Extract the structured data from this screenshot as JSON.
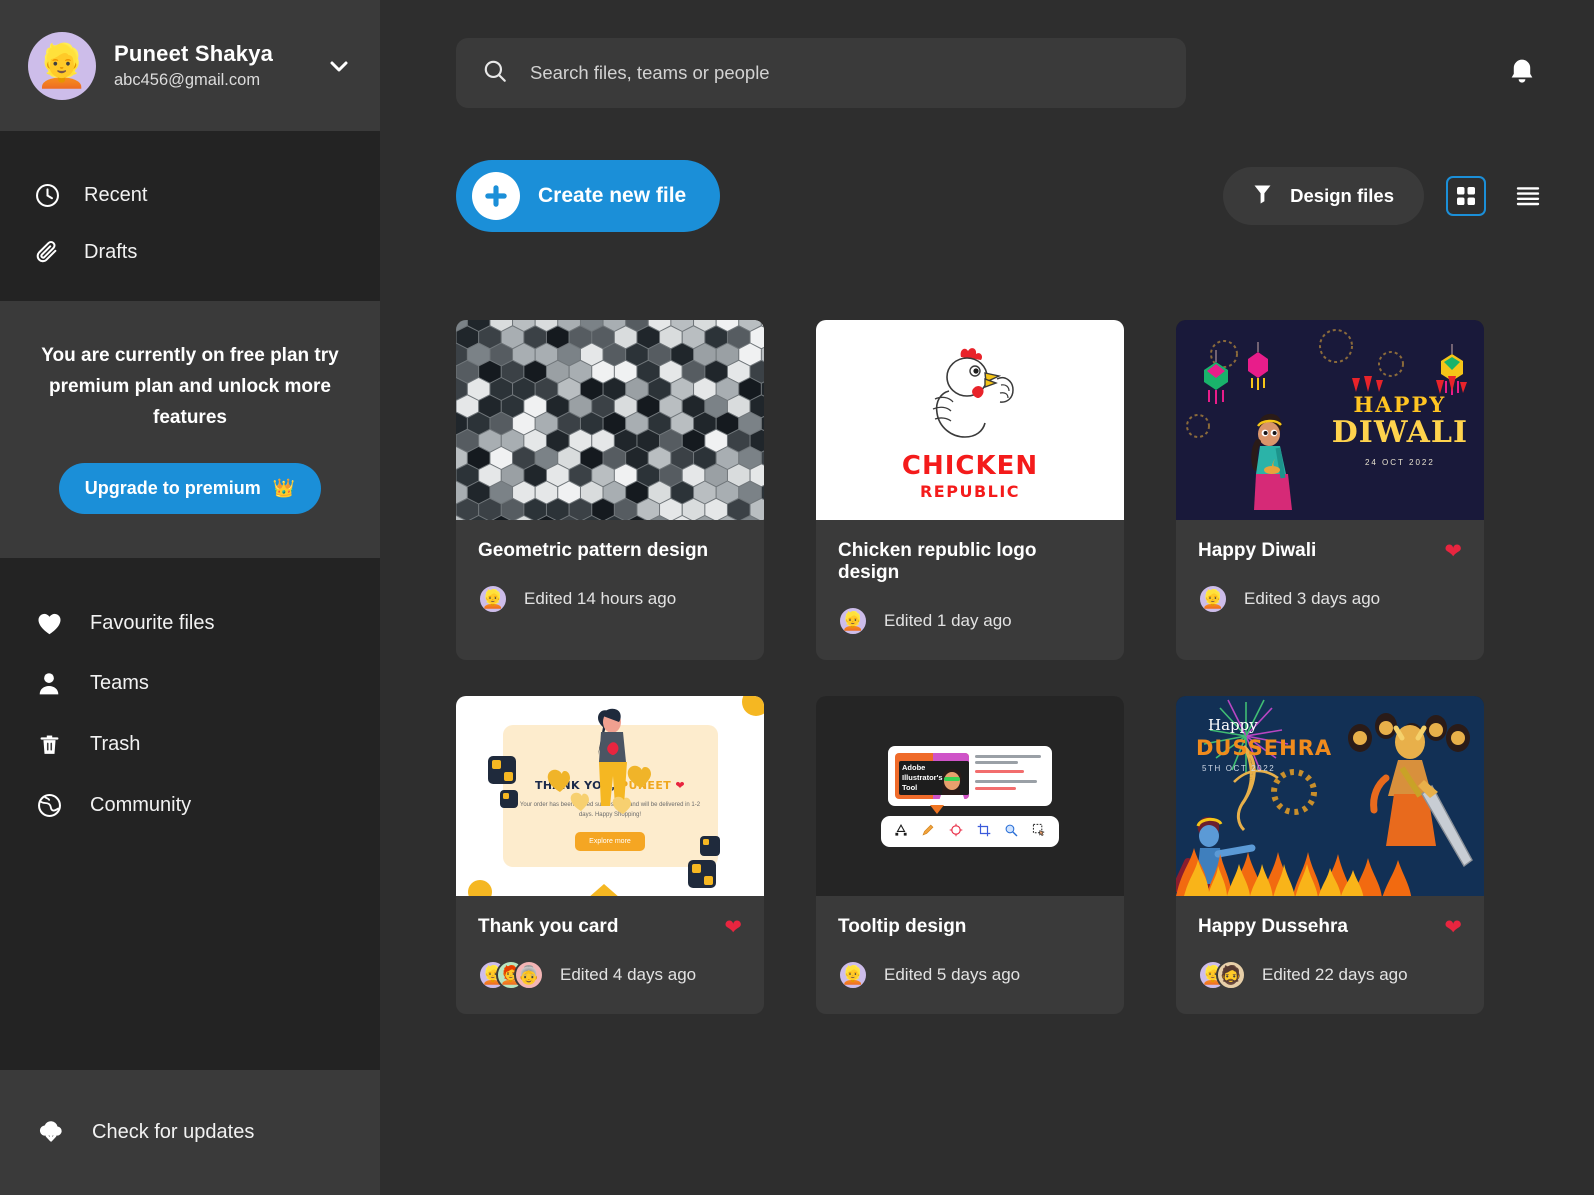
{
  "profile": {
    "name": "Puneet Shakya",
    "email": "abc456@gmail.com",
    "avatar_emoji": "👱",
    "chevron_icon": "chevron-down-icon"
  },
  "sidebar": {
    "nav_top": [
      {
        "label": "Recent",
        "icon": "clock-icon"
      },
      {
        "label": "Drafts",
        "icon": "paperclip-icon"
      }
    ],
    "promo": {
      "text": "You are currently on free plan try premium plan and unlock more features",
      "button_label": "Upgrade to premium",
      "button_icon": "👑",
      "accent": "#1b8fd8"
    },
    "nav_bottom": [
      {
        "label": "Favourite files",
        "icon": "heart-icon"
      },
      {
        "label": "Teams",
        "icon": "person-icon"
      },
      {
        "label": "Trash",
        "icon": "trash-icon"
      },
      {
        "label": "Community",
        "icon": "globe-icon"
      }
    ],
    "footer": {
      "label": "Check for updates",
      "icon": "cloud-download-icon"
    }
  },
  "topbar": {
    "search_placeholder": "Search files, teams or people",
    "search_value": "",
    "search_icon": "search-icon",
    "bell_icon": "notification-bell-icon"
  },
  "actionbar": {
    "create_label": "Create new file",
    "create_icon": "plus-icon",
    "filter_label": "Design files",
    "filter_icon": "funnel-icon",
    "grid_view_icon": "grid-view-icon",
    "list_view_icon": "list-view-icon",
    "active_view": "grid"
  },
  "cards": [
    {
      "title": "Geometric pattern design",
      "edited": "Edited 14 hours ago",
      "favourite": false,
      "thumb": "geometric-hexagon-mosaic",
      "avatars": [
        "👱"
      ]
    },
    {
      "title": "Chicken republic logo design",
      "edited": "Edited 1 day ago",
      "favourite": false,
      "thumb": "chicken-republic-logo",
      "thumb_text": {
        "line1": "CHICKEN",
        "line2": "REPUBLIC"
      },
      "avatars": [
        "👱"
      ]
    },
    {
      "title": "Happy Diwali",
      "edited": "Edited 3 days ago",
      "favourite": true,
      "thumb": "happy-diwali-poster",
      "thumb_text": {
        "line1": "HAPPY",
        "line2": "DIWALI",
        "date": "24 OCT 2022"
      },
      "avatars": [
        "👱"
      ]
    },
    {
      "title": "Thank you card",
      "edited": "Edited 4 days ago",
      "favourite": true,
      "thumb": "thank-you-card",
      "thumb_text": {
        "title_main": "THANK YOU, ",
        "title_name": "PUNEET",
        "body": "Your order has been placed successfully and will be delivered in 1-2 days. Happy Shopping!",
        "button": "Explore more"
      },
      "avatars": [
        "👱",
        "🧑‍🦰",
        "👵"
      ]
    },
    {
      "title": "Tooltip design",
      "edited": "Edited 5 days ago",
      "favourite": false,
      "thumb": "tooltip-design",
      "thumb_text": {
        "popup": "Adobe Illustrator's Pen Tool"
      },
      "avatars": [
        "👱"
      ]
    },
    {
      "title": "Happy Dussehra",
      "edited": "Edited 22 days ago",
      "favourite": true,
      "thumb": "happy-dussehra-poster",
      "thumb_text": {
        "line1": "Happy",
        "line2": "DUSSEHRA",
        "date": "5TH OCT 2022"
      },
      "avatars": [
        "👱",
        "🧔"
      ]
    }
  ],
  "colors": {
    "accent": "#1b8fd8",
    "favourite": "#e8253f",
    "sidebar_bg": "#232323",
    "panel_bg": "#3a3a3a",
    "main_bg": "#2e2e2e"
  }
}
